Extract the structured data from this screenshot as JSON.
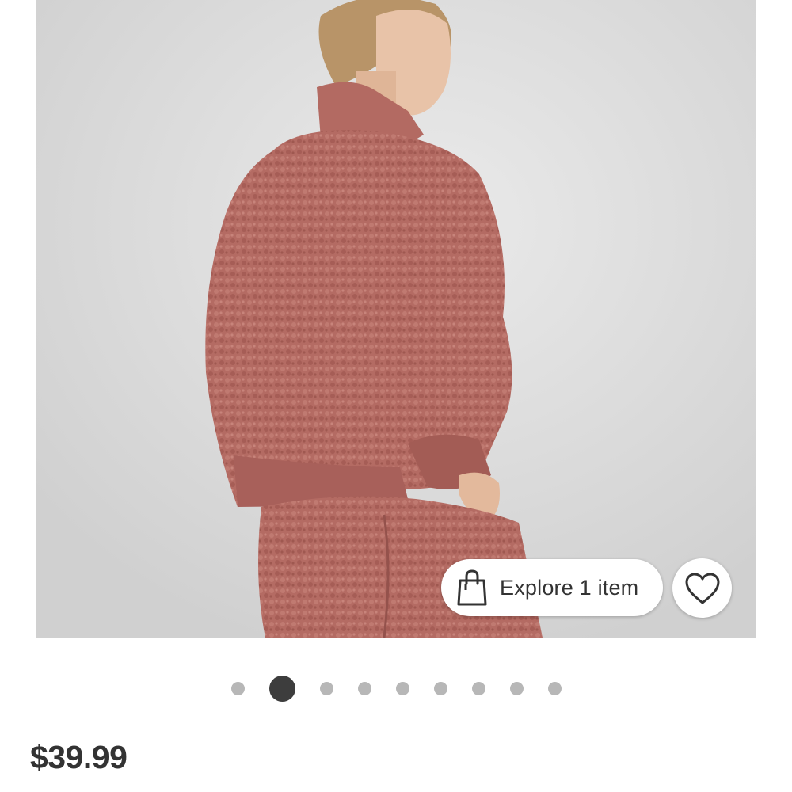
{
  "product": {
    "image_alt": "",
    "price": "$39.99"
  },
  "explore": {
    "label": "Explore 1 item",
    "icon": "shopping-bag-icon"
  },
  "favorite": {
    "icon": "heart-outline-icon"
  },
  "carousel": {
    "total": 9,
    "active_index": 1
  },
  "colors": {
    "accent_text": "#333333",
    "dot_inactive": "#b7b7b7",
    "dot_active": "#3d3d3d",
    "sweater": "#b56a63"
  }
}
